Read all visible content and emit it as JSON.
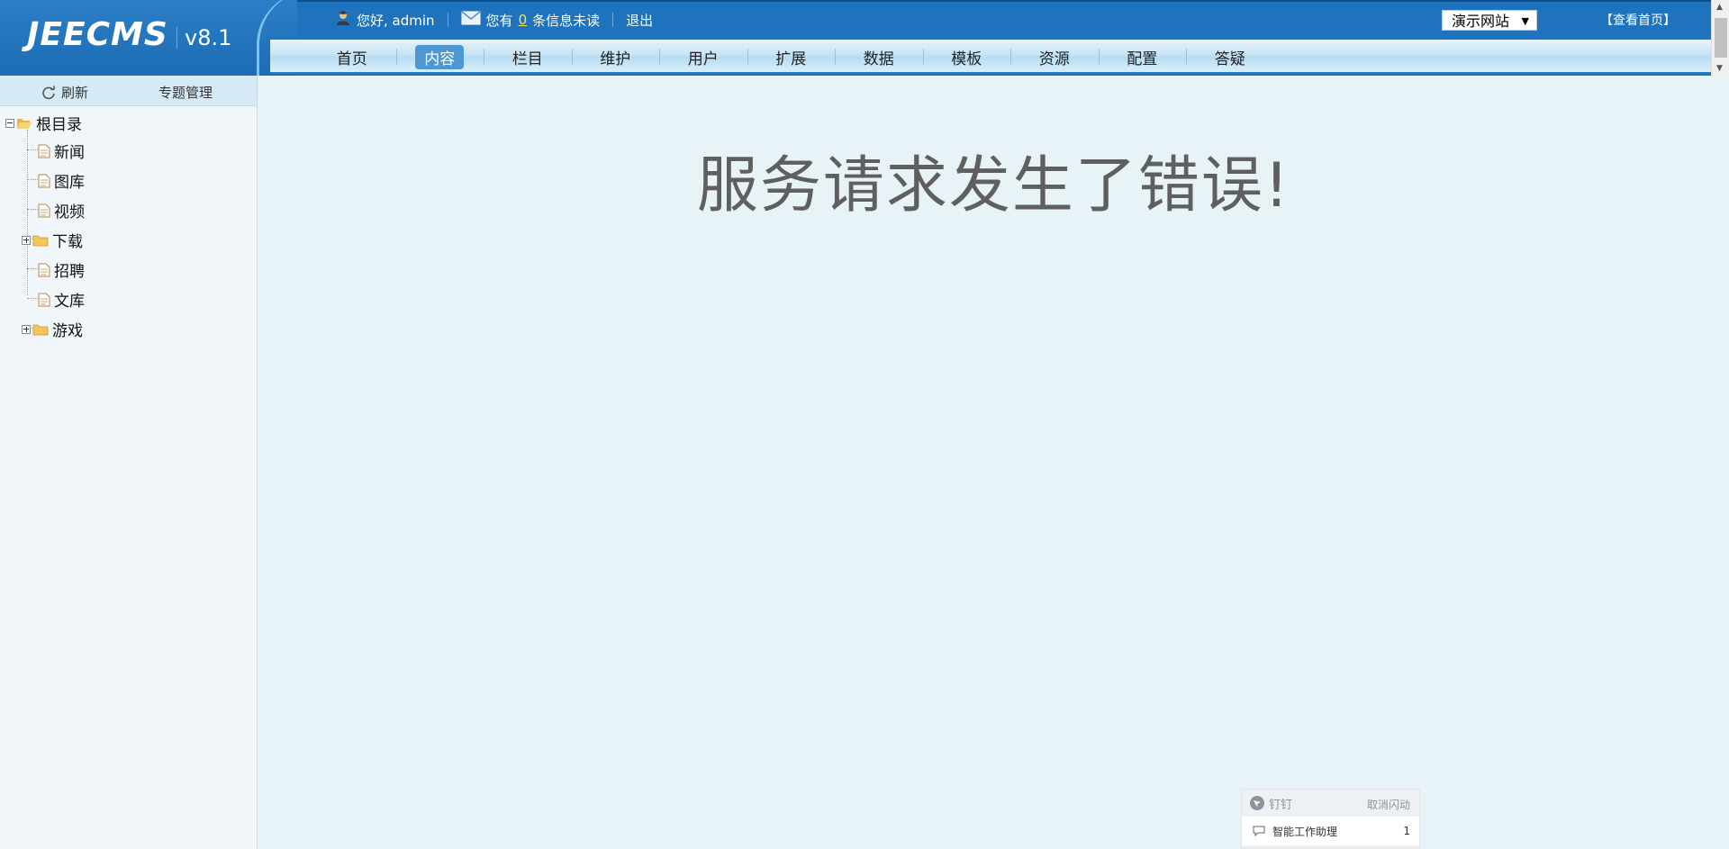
{
  "header": {
    "logo": "JEECMS",
    "version": "v8.1",
    "greeting": "您好, admin",
    "msg_prefix": "您有",
    "msg_count": "0",
    "msg_suffix": "条信息未读",
    "logout": "退出",
    "site_select": "演示网站",
    "view_home": "【查看首页】",
    "user_icon": "user-icon",
    "mail_icon": "mail-icon"
  },
  "nav": {
    "items": [
      "首页",
      "内容",
      "栏目",
      "维护",
      "用户",
      "扩展",
      "数据",
      "模板",
      "资源",
      "配置",
      "答疑"
    ],
    "active_index": 1,
    "active_color": "#4d98d3"
  },
  "sidebar": {
    "refresh": "刷新",
    "special": "专题管理",
    "root": "根目录",
    "children": [
      {
        "label": "新闻",
        "type": "doc"
      },
      {
        "label": "图库",
        "type": "doc"
      },
      {
        "label": "视频",
        "type": "doc"
      },
      {
        "label": "下载",
        "type": "folder"
      },
      {
        "label": "招聘",
        "type": "doc"
      },
      {
        "label": "文库",
        "type": "doc"
      },
      {
        "label": "游戏",
        "type": "folder"
      }
    ]
  },
  "main": {
    "error": "服务请求发生了错误!"
  },
  "ding": {
    "title": "钉钉",
    "cancel": "取消闪动",
    "item_label": "智能工作助理",
    "item_count": "1"
  },
  "colors": {
    "header_blue": "#1f73bd",
    "nav_light": "#c8e5f5",
    "main_bg": "#e8f3f8",
    "error_text": "#5f5f5f"
  }
}
